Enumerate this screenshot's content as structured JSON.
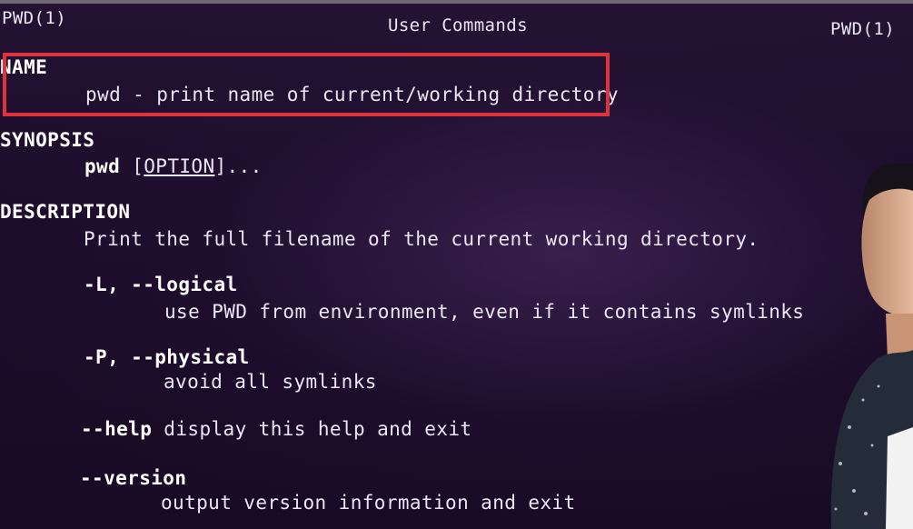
{
  "header": {
    "left": "PWD(1)",
    "center": "User Commands",
    "right": "PWD(1)"
  },
  "sections": {
    "name": {
      "heading": "NAME",
      "text": "pwd - print name of current/working directory"
    },
    "synopsis": {
      "heading": "SYNOPSIS",
      "command": "pwd",
      "open_bracket": "[",
      "option": "OPTION",
      "close": "]..."
    },
    "description": {
      "heading": "DESCRIPTION",
      "text": "Print the full filename of the current working directory.",
      "options": [
        {
          "flag": "-L, --logical",
          "text": "use PWD from environment, even if it contains symlinks"
        },
        {
          "flag": "-P, --physical",
          "text": "avoid all symlinks"
        },
        {
          "flag": "--help",
          "text": " display this help and exit"
        },
        {
          "flag": "--version",
          "text": "output version information and exit"
        }
      ]
    }
  },
  "colors": {
    "background": "#1c0d2a",
    "text": "#ece6f4",
    "highlight_border": "#e0323a"
  }
}
